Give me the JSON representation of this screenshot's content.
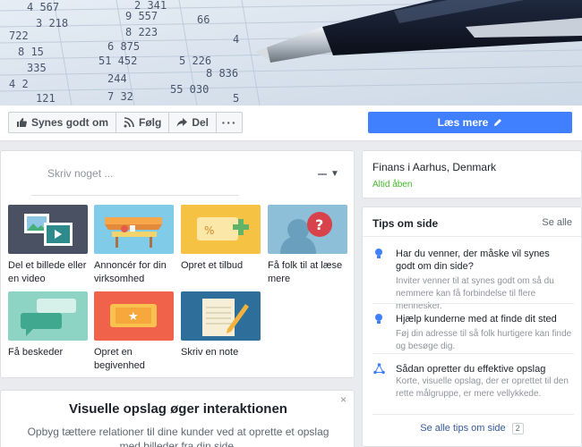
{
  "actions": {
    "like": "Synes godt om",
    "follow": "Følg",
    "share": "Del",
    "more": "···",
    "cta": "Læs mere"
  },
  "composer": {
    "placeholder": "Skriv noget ...",
    "tiles": [
      {
        "label": "Del et billede eller en video",
        "icon": "photo-video-icon"
      },
      {
        "label": "Annoncér for din virksomhed",
        "icon": "shop-stand-icon"
      },
      {
        "label": "Opret et tilbud",
        "icon": "offer-coupon-icon"
      },
      {
        "label": "Få folk til at læse mere",
        "icon": "question-person-icon"
      },
      {
        "label": "Få beskeder",
        "icon": "chat-bubbles-icon"
      },
      {
        "label": "Opret en begivenhed",
        "icon": "event-ticket-icon"
      },
      {
        "label": "Skriv en note",
        "icon": "note-pencil-icon"
      }
    ]
  },
  "visual_card": {
    "title": "Visuelle opslag øger interaktionen",
    "body": "Opbyg tættere relationer til dine kunder ved at oprette et opslag med billeder fra din side.",
    "close": "×"
  },
  "location": {
    "name": "Finans i Aarhus, Denmark",
    "status": "Altid åben"
  },
  "tips": {
    "title": "Tips om side",
    "see_all": "Se alle",
    "items": [
      {
        "title": "Har du venner, der måske vil synes godt om din side?",
        "body": "Inviter venner til at synes godt om så du nemmere kan få forbindelse til flere mennesker.",
        "icon": "lightbulb-icon"
      },
      {
        "title": "Hjælp kunderne med at finde dit sted",
        "body": "Føj din adresse til så folk hurtigere kan finde og besøge dig.",
        "icon": "lightbulb-icon"
      },
      {
        "title": "Sådan opretter du effektive opslag",
        "body": "Korte, visuelle opslag, der er oprettet til den rette målgruppe, er mere vellykkede.",
        "icon": "share-nodes-icon"
      }
    ],
    "footer": "Se alle tips om side",
    "footer_count": "2"
  },
  "colors": {
    "primary_button": "#4080ff",
    "open_status": "#42b72a",
    "link": "#365899"
  }
}
